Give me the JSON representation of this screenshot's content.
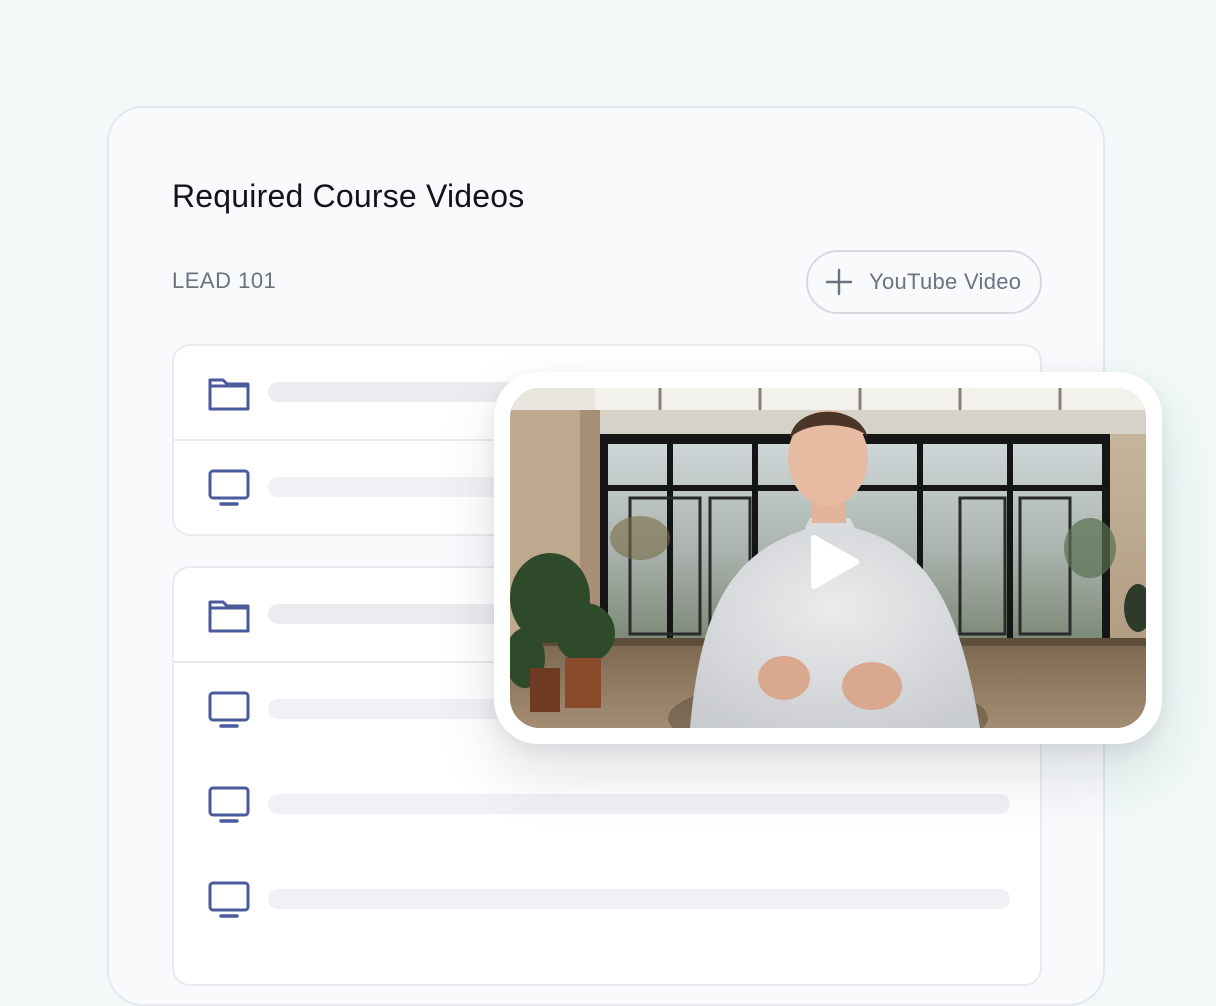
{
  "card": {
    "title": "Required Course Videos",
    "course_code": "LEAD 101",
    "add_button_label": "YouTube Video"
  },
  "groups": [
    {
      "items": [
        {
          "icon": "folder-icon"
        },
        {
          "icon": "monitor-icon"
        }
      ]
    },
    {
      "items": [
        {
          "icon": "folder-icon"
        },
        {
          "icon": "monitor-icon"
        },
        {
          "icon": "monitor-icon"
        },
        {
          "icon": "monitor-icon"
        }
      ]
    }
  ],
  "video": {
    "icon": "play-icon"
  },
  "colors": {
    "background": "#f2f9f8",
    "icon_accent": "#4a5a9c",
    "muted_text": "#6b7280"
  }
}
